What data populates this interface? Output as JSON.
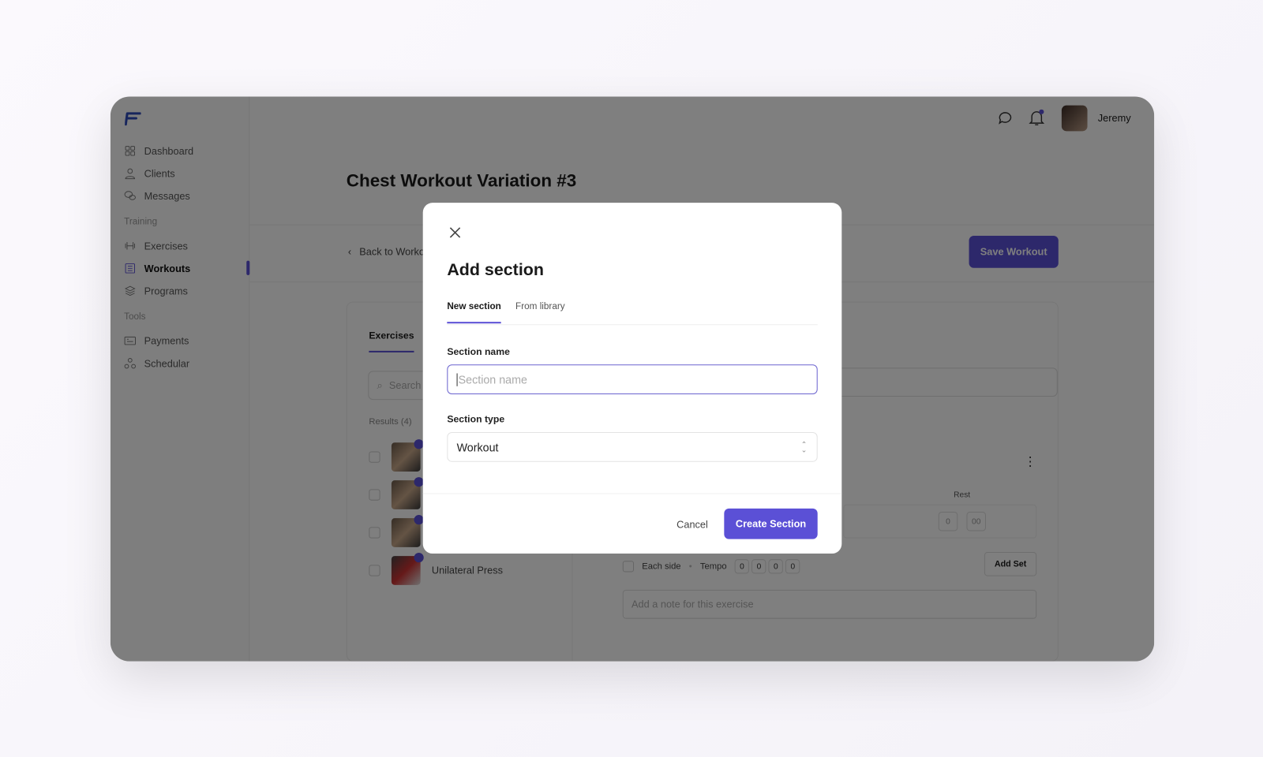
{
  "sidebar": {
    "items": [
      {
        "label": "Dashboard",
        "icon": "grid-icon"
      },
      {
        "label": "Clients",
        "icon": "user-icon"
      },
      {
        "label": "Messages",
        "icon": "chat-icon"
      }
    ],
    "training_label": "Training",
    "training": [
      {
        "label": "Exercises",
        "icon": "dumbbell-icon"
      },
      {
        "label": "Workouts",
        "icon": "list-icon",
        "active": true
      },
      {
        "label": "Programs",
        "icon": "layers-icon"
      }
    ],
    "tools_label": "Tools",
    "tools": [
      {
        "label": "Payments",
        "icon": "card-icon"
      },
      {
        "label": "Schedular",
        "icon": "schedule-icon"
      }
    ]
  },
  "header": {
    "user_name": "Jeremy",
    "has_notification": true
  },
  "page": {
    "title": "Chest Workout Variation #3",
    "back_label": "Back to Workouts",
    "save_label": "Save Workout",
    "tab": "Exercises",
    "search_placeholder": "Search",
    "results_label": "Results (4)",
    "results": [
      "",
      "",
      "",
      "Unilateral Press"
    ],
    "rest_label": "Rest",
    "rest_min": "0",
    "rest_sec": "00",
    "each_side": "Each side",
    "tempo_label": "Tempo",
    "tempo": [
      "0",
      "0",
      "0",
      "0"
    ],
    "add_set": "Add Set",
    "note_placeholder": "Add a note for this exercise"
  },
  "modal": {
    "title": "Add section",
    "tabs": [
      "New section",
      "From library"
    ],
    "active_tab": 0,
    "name_label": "Section name",
    "name_placeholder": "Section name",
    "name_value": "",
    "type_label": "Section type",
    "type_value": "Workout",
    "cancel": "Cancel",
    "create": "Create Section"
  },
  "colors": {
    "accent": "#5b50d6"
  }
}
